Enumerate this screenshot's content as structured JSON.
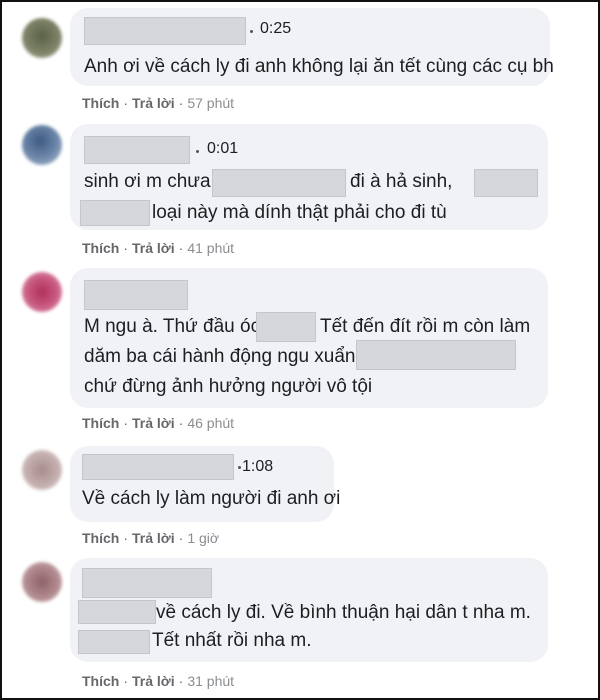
{
  "actions": {
    "like": "Thích",
    "reply": "Trả lời"
  },
  "comments": [
    {
      "video_time": "0:25",
      "line1": "Anh ơi về cách ly đi anh không lại ăn tết cùng các cụ bh",
      "ago": "57 phút"
    },
    {
      "video_time": "0:01",
      "line1_a": "sinh ơi m chưa",
      "line1_b": "đi à hả sinh,",
      "line2": "loại này mà dính thật phải cho đi tù",
      "ago": "41 phút"
    },
    {
      "line1_a": "M ngu à. Thứ đầu óc",
      "line1_b": "Tết đến đít rồi m còn làm",
      "line2": "dăm ba cái hành động ngu xuẩn.",
      "line3": "chứ đừng ảnh hưởng người vô tội",
      "ago": "46 phút"
    },
    {
      "video_time": "1:08",
      "line1": "Về cách ly làm người đi anh ơi",
      "ago": "1 giờ"
    },
    {
      "line1": "về cách ly đi. Về bình thuận hại dân t nha m.",
      "line2": "Tết nhất rồi nha m.",
      "ago": "31 phút"
    }
  ]
}
